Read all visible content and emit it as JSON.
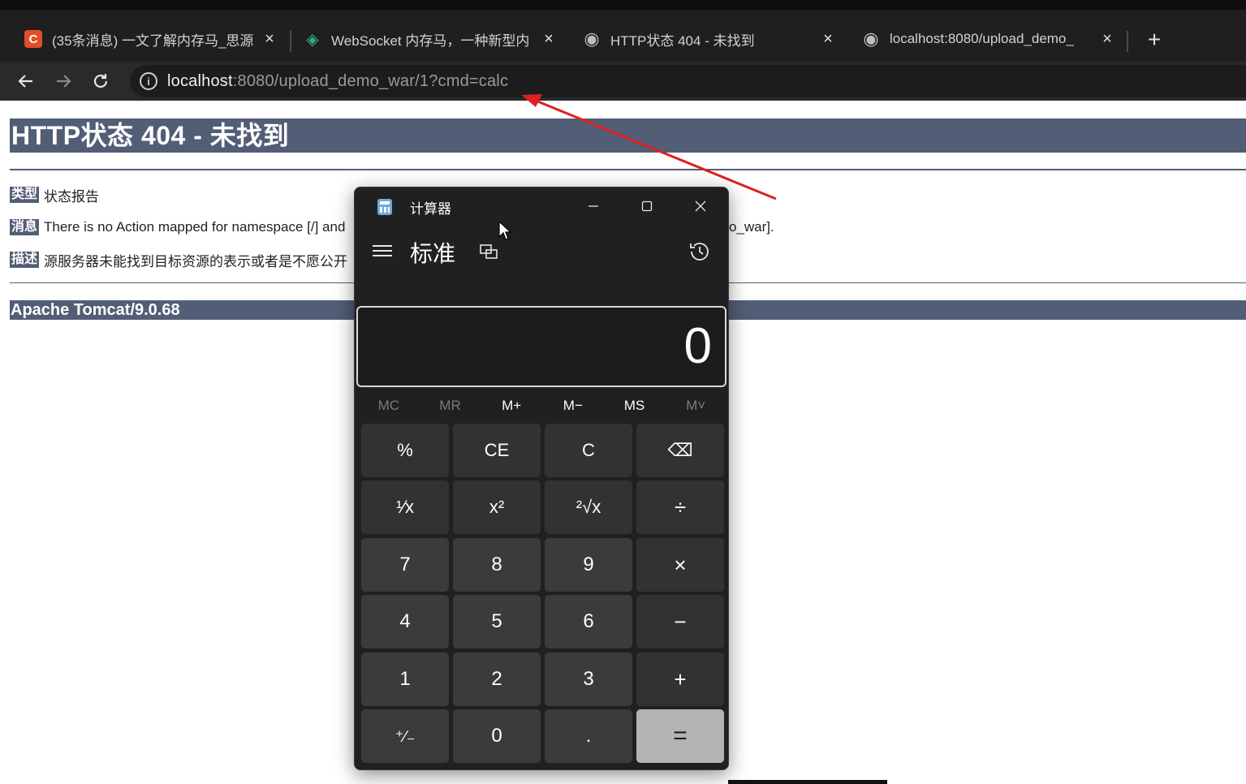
{
  "browser": {
    "tabs": [
      {
        "title": "(35条消息) 一文了解内存马_思源",
        "favicon": "csdn-c-icon",
        "color": "#e04e2a",
        "glyph": "C"
      },
      {
        "title": "WebSocket 内存马，一种新型内",
        "favicon": "shield-icon",
        "color": "#33b08d",
        "glyph": "◈"
      },
      {
        "title": "HTTP状态 404 - 未找到",
        "favicon": "globe-icon",
        "color": "#bdbdbd",
        "glyph": "◉"
      },
      {
        "title": "localhost:8080/upload_demo_",
        "favicon": "globe-icon",
        "color": "#bdbdbd",
        "glyph": "◉"
      }
    ],
    "tab_close": "×",
    "new_tab": "+",
    "address": {
      "host": "localhost",
      "rest": ":8080/upload_demo_war/1?cmd=calc"
    }
  },
  "error_page": {
    "heading": "HTTP状态 404 - 未找到",
    "type_label": "类型",
    "type_value": "状态报告",
    "message_label": "消息",
    "message_value": "There is no Action mapped for namespace [/] and",
    "message_tail": "o_war].",
    "desc_label": "描述",
    "desc_value": "源服务器未能找到目标资源的表示或者是不愿公开",
    "footer": "Apache Tomcat/9.0.68"
  },
  "calculator": {
    "app_name": "计算器",
    "mode": "标准",
    "display_value": "0",
    "memory": [
      {
        "label": "MC",
        "enabled": false
      },
      {
        "label": "MR",
        "enabled": false
      },
      {
        "label": "M+",
        "enabled": true
      },
      {
        "label": "M−",
        "enabled": true
      },
      {
        "label": "MS",
        "enabled": true
      },
      {
        "label": "M˅",
        "enabled": false
      }
    ],
    "keys": [
      [
        "%",
        "CE",
        "C",
        "⌫"
      ],
      [
        "¹⁄x",
        "x²",
        "²√x",
        "÷"
      ],
      [
        "7",
        "8",
        "9",
        "×"
      ],
      [
        "4",
        "5",
        "6",
        "−"
      ],
      [
        "1",
        "2",
        "3",
        "+"
      ],
      [
        "⁺∕₋",
        "0",
        ".",
        "="
      ]
    ]
  },
  "colors": {
    "tomcat_header": "#525d76",
    "annotation_arrow": "#e02020",
    "calc_background": "#202020",
    "equals_key": "#b3b3b3"
  }
}
